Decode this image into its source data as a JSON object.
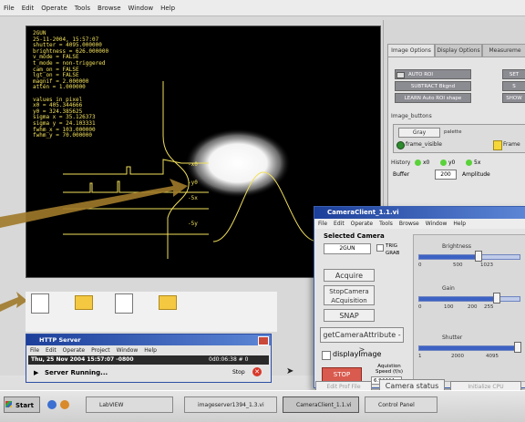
{
  "main_menu": [
    "File",
    "Edit",
    "Operate",
    "Tools",
    "Browse",
    "Window",
    "Help"
  ],
  "params_text": "2GUN\n25-11-2004, 15:57:07\nshutter = 4095.000000\nbrightness = 626.000000\nv_mode = FALSE\nt_mode = non-triggered\ncam_on = FALSE\nlgt_on = FALSE\nmagnif = 2.000000\nattén = 1.000000\n\nvalues in pixel\nx0 = 405.344666\ny0 = 324.385625\nsigma x = 35.126373\nsigma y = 24.103331\nfwhm_x = 103.000000\nfwhm_y = 70.000000",
  "trace_labels": [
    "-x0",
    "-y0",
    "-5x",
    "-5y"
  ],
  "right_panel": {
    "tabs": [
      "Image Options",
      "Display Options",
      "Measureme"
    ],
    "auto_roi": "AUTO ROI",
    "set": "SET",
    "subtract": "SUBTRACT Bkgnd",
    "learn": "LEARN Auto ROI shape",
    "show": "SHOW",
    "s_btn": "S",
    "section": "Image_buttons",
    "gray": "Gray",
    "palette": "palette",
    "frame_visible": "frame_visible",
    "frame": "Frame",
    "history": "History",
    "hist_labels": [
      "x0",
      "y0",
      "5x"
    ],
    "buffer": "Buffer",
    "buffer_val": "200",
    "amplitude": "Amplitude"
  },
  "camera_window": {
    "title": "CameraClient_1.1.vi",
    "menu": [
      "File",
      "Edit",
      "Operate",
      "Tools",
      "Browse",
      "Window",
      "Help"
    ],
    "selected_camera_label": "Selected Camera",
    "selected_camera": "2GUN",
    "trig": "TRIG",
    "grab": "GRAB",
    "acquire": "Acquire",
    "stop_camera": "StopCamera ACquisition",
    "snap": "SNAP",
    "get_attr": "getCameraAttribute ->",
    "display_image": "displayImage",
    "stop": "STOP",
    "acq_speed_label": "Aquistion Speed (f/s)",
    "acq_speed": "6.94444",
    "brightness": {
      "label": "Brightness",
      "scale": [
        "0",
        "500",
        "1023"
      ],
      "fraction": 0.6
    },
    "gain": {
      "label": "Gain",
      "scale": [
        "0",
        "100",
        "200",
        "255"
      ],
      "fraction": 0.78
    },
    "shutter": {
      "label": "Shutter",
      "scale": [
        "1",
        "2000",
        "4095"
      ],
      "fraction": 0.99
    },
    "edit_prof": "Edit Prof File",
    "camera_status": "Camera status",
    "initialize": "Initialize CPU"
  },
  "http_window": {
    "title": "HTTP Server",
    "menu": [
      "File",
      "Edit",
      "Operate",
      "Project",
      "Window",
      "Help"
    ],
    "datetime": "Thu, 25 Nov 2004 15:57:07 -0800",
    "counter": "0d0:06:38 # 0",
    "status": "Server Running...",
    "stop": "Stop"
  },
  "taskbar": {
    "start": "Start",
    "tasks": [
      "LabVIEW",
      "imageserver1394_1.3.vi",
      "CameraClient_1.1.vi",
      "Control Panel"
    ]
  },
  "colors": {
    "accent": "#f2e05a",
    "titlebar": "#1c3f9a",
    "arrow": "#a07a2a"
  }
}
